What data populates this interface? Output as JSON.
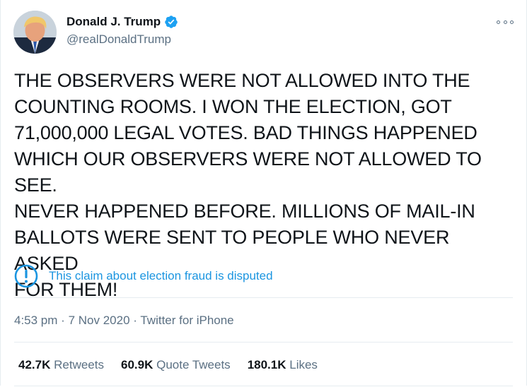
{
  "author": {
    "name": "Donald J. Trump",
    "handle": "@realDonaldTrump",
    "verified": true
  },
  "tweet": {
    "lines": [
      "THE OBSERVERS WERE NOT ALLOWED INTO THE",
      "COUNTING ROOMS. I WON THE ELECTION, GOT",
      "71,000,000 LEGAL VOTES. BAD THINGS HAPPENED",
      "WHICH OUR OBSERVERS WERE NOT ALLOWED TO SEE.",
      "NEVER HAPPENED BEFORE. MILLIONS OF MAIL-IN",
      "BALLOTS WERE SENT TO PEOPLE WHO NEVER ASKED",
      "FOR THEM!"
    ]
  },
  "disclaimer": {
    "icon": "info-circle-icon",
    "text": "This claim about election fraud is disputed"
  },
  "meta": {
    "time": "4:53 pm",
    "separator": "·",
    "date": "7 Nov 2020",
    "source": "Twitter for iPhone"
  },
  "stats": {
    "retweets_count": "42.7K",
    "retweets_label": "Retweets",
    "quote_count": "60.9K",
    "quote_label": "Quote Tweets",
    "likes_count": "180.1K",
    "likes_label": "Likes"
  },
  "colors": {
    "accent": "#1b95e0",
    "secondary_text": "#5b7083",
    "divider": "#e6ecf0"
  }
}
